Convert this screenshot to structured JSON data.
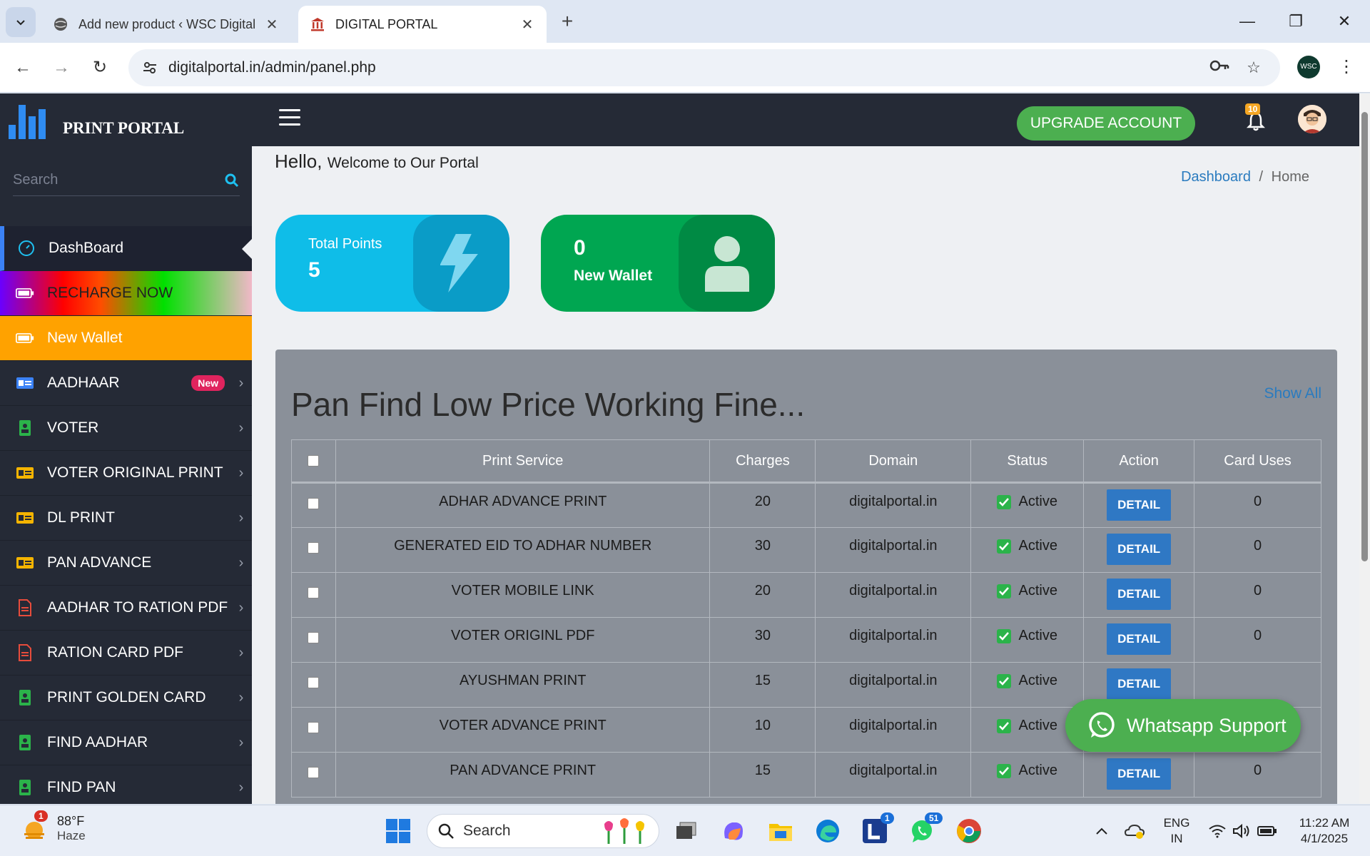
{
  "browser": {
    "tabs": [
      {
        "title": "Add new product ‹ WSC Digital"
      },
      {
        "title": "DIGITAL PORTAL"
      }
    ],
    "new_tab": "+",
    "url": "digitalportal.in/admin/panel.php",
    "profile_initials": "WSC"
  },
  "sidebar": {
    "logo_text": "PRINT PORTAL",
    "search_placeholder": "Search",
    "items": [
      {
        "label": "DashBoard"
      },
      {
        "label": "RECHARGE NOW"
      },
      {
        "label": "New Wallet"
      },
      {
        "label": "AADHAAR",
        "badge": "New"
      },
      {
        "label": "VOTER"
      },
      {
        "label": "VOTER ORIGINAL PRINT"
      },
      {
        "label": "DL PRINT"
      },
      {
        "label": "PAN ADVANCE"
      },
      {
        "label": "AADHAR TO RATION PDF"
      },
      {
        "label": "RATION CARD PDF"
      },
      {
        "label": "PRINT GOLDEN CARD"
      },
      {
        "label": "FIND AADHAR"
      },
      {
        "label": "FIND PAN"
      }
    ]
  },
  "topnav": {
    "upgrade_label": "UPGRADE ACCOUNT",
    "notifications": "10"
  },
  "content": {
    "hello": "Hello,",
    "welcome": "Welcome to Our Portal",
    "breadcrumb": {
      "link": "Dashboard",
      "separator": "/",
      "current": "Home"
    },
    "cards": {
      "points": {
        "label": "Total Points",
        "value": "5"
      },
      "wallet": {
        "value": "0",
        "label": "New Wallet"
      }
    },
    "panel": {
      "title": "Pan Find Low Price Working Fine...",
      "show_all": "Show All",
      "columns": [
        "Print Service",
        "Charges",
        "Domain",
        "Status",
        "Action",
        "Card Uses"
      ],
      "rows": [
        {
          "service": "ADHAR ADVANCE PRINT",
          "charges": "20",
          "domain": "digitalportal.in",
          "status": "Active",
          "action": "DETAIL",
          "uses": "0"
        },
        {
          "service": "GENERATED EID TO ADHAR NUMBER",
          "charges": "30",
          "domain": "digitalportal.in",
          "status": "Active",
          "action": "DETAIL",
          "uses": "0"
        },
        {
          "service": "VOTER MOBILE LINK",
          "charges": "20",
          "domain": "digitalportal.in",
          "status": "Active",
          "action": "DETAIL",
          "uses": "0"
        },
        {
          "service": "VOTER ORIGINL PDF",
          "charges": "30",
          "domain": "digitalportal.in",
          "status": "Active",
          "action": "DETAIL",
          "uses": "0"
        },
        {
          "service": "AYUSHMAN PRINT",
          "charges": "15",
          "domain": "digitalportal.in",
          "status": "Active",
          "action": "DETAIL",
          "uses": ""
        },
        {
          "service": "VOTER ADVANCE PRINT",
          "charges": "10",
          "domain": "digitalportal.in",
          "status": "Active",
          "action": "",
          "uses": ""
        },
        {
          "service": "PAN ADVANCE PRINT",
          "charges": "15",
          "domain": "digitalportal.in",
          "status": "Active",
          "action": "DETAIL",
          "uses": "0"
        }
      ]
    },
    "whatsapp_label": "Whatsapp Support"
  },
  "taskbar": {
    "weather_temp": "88°F",
    "weather_desc": "Haze",
    "weather_badge": "1",
    "search_placeholder": "Search",
    "badge_l": "1",
    "badge_whatsapp": "51",
    "lang": "ENG",
    "region": "IN",
    "time": "11:22 AM",
    "date": "4/1/2025"
  },
  "colors": {
    "sidebar_bg": "#252a36",
    "accent_green": "#4caf50",
    "points_card": "#0fbde8",
    "wallet_card": "#00a651",
    "wallet_item": "#ffa200",
    "detail_button": "#2f78c4"
  }
}
